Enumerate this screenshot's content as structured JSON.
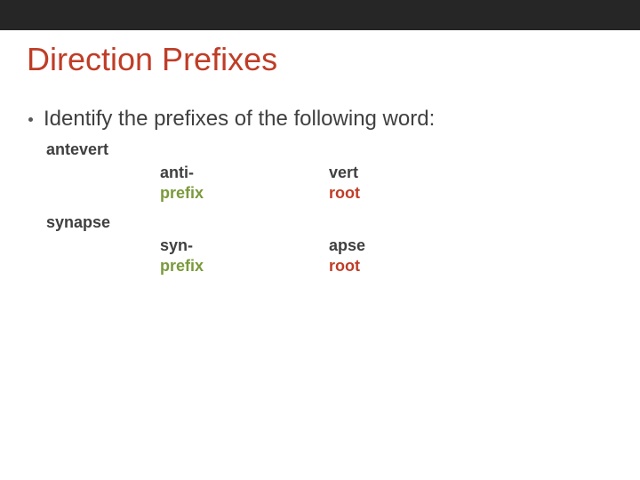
{
  "title": "Direction Prefixes",
  "bullet": "Identify the prefixes of the following word:",
  "items": [
    {
      "word": "antevert",
      "prefix_part": "anti-",
      "prefix_label": "prefix",
      "root_part": "vert",
      "root_label": "root"
    },
    {
      "word": "synapse",
      "prefix_part": "syn-",
      "prefix_label": "prefix",
      "root_part": "apse",
      "root_label": "root"
    }
  ]
}
